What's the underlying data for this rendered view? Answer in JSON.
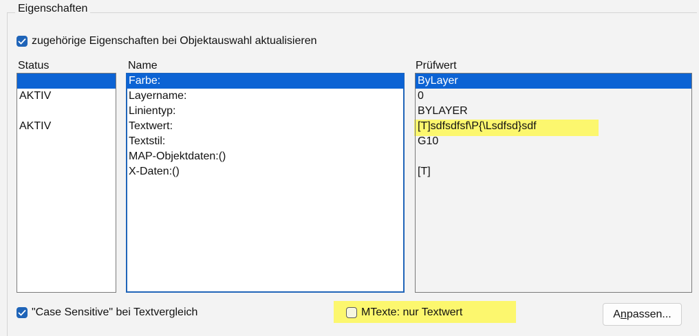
{
  "group": {
    "title": "Eigenschaften"
  },
  "update_checkbox": {
    "label": "zugehörige Eigenschaften bei Objektauswahl aktualisieren",
    "checked": true
  },
  "columns": {
    "status": "Status",
    "name": "Name",
    "pruefwert": "Prüfwert"
  },
  "status_list": [
    "",
    "AKTIV",
    "",
    "AKTIV",
    "",
    "",
    "",
    ""
  ],
  "name_list": [
    "Farbe:",
    "Layername:",
    "Linientyp:",
    "Textwert:",
    "Textstil:",
    "MAP-Objektdaten:()",
    "X-Daten:()"
  ],
  "pruefwert_list": [
    "ByLayer",
    "0",
    "BYLAYER",
    "[T]sdfsdfsf\\P{\\Lsdfsd}sdf",
    "G10",
    "",
    "[T]"
  ],
  "selected_index": 0,
  "case_sensitive_checkbox": {
    "label": "\"Case Sensitive\" bei Textvergleich",
    "checked": true
  },
  "mtexte_checkbox": {
    "label": "MTexte: nur Textwert",
    "checked": false
  },
  "adjust_button": {
    "label_before": "A",
    "label_mnemonic": "n",
    "label_after": "passen..."
  },
  "colors": {
    "accent": "#1f64b8",
    "selection": "#0c63d4",
    "highlight": "#fcf76e"
  }
}
